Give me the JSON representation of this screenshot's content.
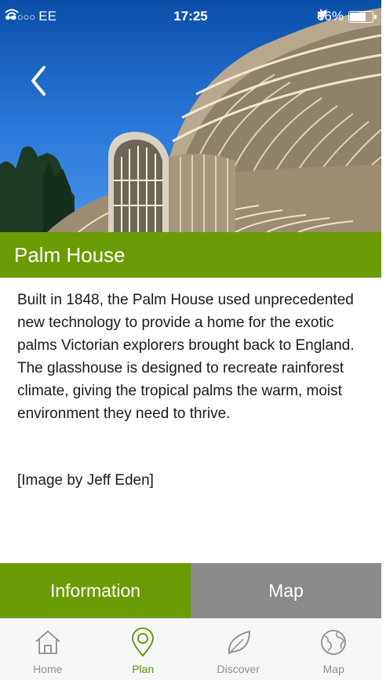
{
  "status_bar": {
    "carrier_dots": "●●○○○",
    "carrier": "EE",
    "time": "17:25",
    "battery": "66%"
  },
  "page": {
    "title": "Palm House",
    "description": "Built in 1848, the Palm House used unprecedented new technology to provide a home for the exotic palms Victorian explorers brought back to England. The glasshouse is designed to recreate rainforest climate, giving the tropical palms the warm, moist environment they need to thrive.",
    "credit": "[Image by Jeff Eden]"
  },
  "tabs": {
    "information": "Information",
    "map": "Map"
  },
  "nav": {
    "items": [
      {
        "label": "Home",
        "icon": "home-icon"
      },
      {
        "label": "Plan",
        "icon": "map-pin-icon"
      },
      {
        "label": "Discover",
        "icon": "leaf-icon"
      },
      {
        "label": "Map",
        "icon": "globe-icon"
      }
    ]
  },
  "colors": {
    "accent_green": "#6b9b05",
    "tab_gray": "#8a8a8a",
    "nav_active": "#5f8f0a",
    "nav_inactive": "#8e8e8e"
  }
}
